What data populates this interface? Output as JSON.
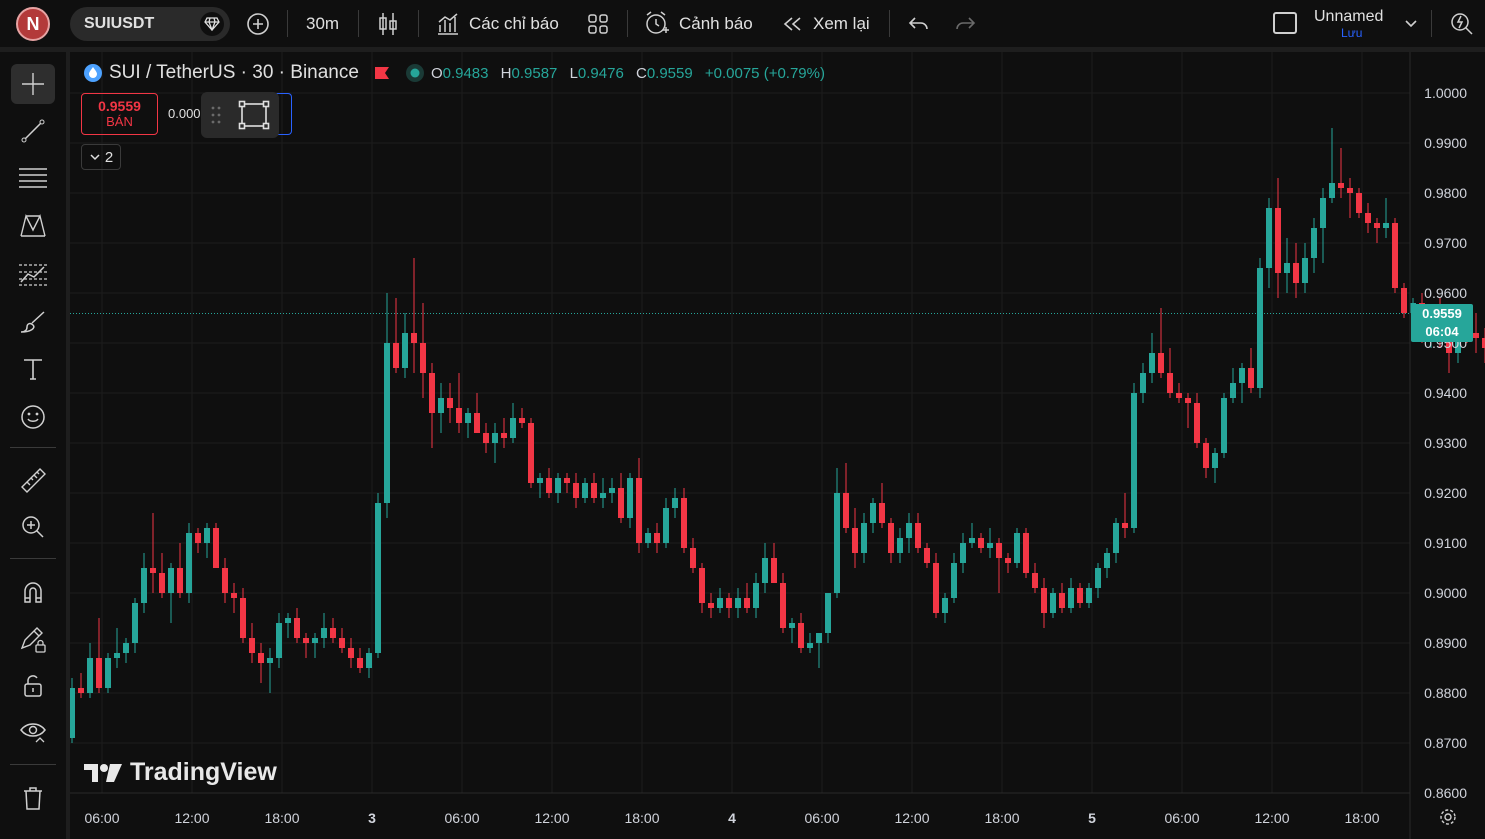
{
  "topbar": {
    "avatar_letter": "N",
    "symbol": "SUIUSDT",
    "interval": "30m",
    "indicators_label": "Các chỉ báo",
    "alerts_label": "Cảnh báo",
    "replay_label": "Xem lại",
    "layout_name": "Unnamed",
    "save_label": "Lưu"
  },
  "legend": {
    "title": "SUI / TetherUS · 30 · Binance",
    "o_key": "O",
    "o_val": "0.9483",
    "h_key": "H",
    "h_val": "0.9587",
    "l_key": "L",
    "l_val": "0.9476",
    "c_key": "C",
    "c_val": "0.9559",
    "change": "+0.0075 (+0.79%)"
  },
  "trade": {
    "sell_price": "0.9559",
    "sell_label": "BÁN",
    "spread": "0.000"
  },
  "collapse_count": "2",
  "watermark": "TradingView",
  "last_price": {
    "price": "0.9559",
    "countdown": "06:04"
  },
  "colors": {
    "up": "#26a69a",
    "down": "#f23645",
    "background": "#0f0f0f",
    "accent": "#2962ff"
  },
  "icons": {
    "crosshair": "crosshair-icon",
    "trendline": "trend-line-icon",
    "fib": "fib-retracement-icon",
    "pattern": "xabcd-pattern-icon",
    "forecast": "forecast-icon",
    "brush": "brush-icon",
    "text": "text-icon",
    "emoji": "emoji-icon",
    "ruler": "ruler-icon",
    "zoom": "zoom-in-icon",
    "magnet": "magnet-icon",
    "lock-draw": "lock-drawing-icon",
    "lock": "lock-icon",
    "eye": "eye-icon",
    "trash": "trash-icon"
  },
  "chart_data": {
    "type": "candlestick",
    "symbol": "SUI / TetherUS",
    "interval": "30",
    "exchange": "Binance",
    "y_ticks": [
      "1.0000",
      "0.9900",
      "0.9800",
      "0.9700",
      "0.9600",
      "0.9500",
      "0.9400",
      "0.9300",
      "0.9200",
      "0.9100",
      "0.9000",
      "0.8900",
      "0.8800",
      "0.8700",
      "0.8600"
    ],
    "x_ticks": [
      "06:00",
      "12:00",
      "18:00",
      "3",
      "06:00",
      "12:00",
      "18:00",
      "4",
      "06:00",
      "12:00",
      "18:00",
      "5",
      "06:00",
      "12:00",
      "18:00"
    ],
    "ylim": [
      0.86,
      1.0
    ],
    "last_close": 0.9559,
    "candles": [
      [
        0.871,
        0.883,
        0.87,
        0.881
      ],
      [
        0.881,
        0.884,
        0.879,
        0.88
      ],
      [
        0.88,
        0.89,
        0.879,
        0.887
      ],
      [
        0.887,
        0.895,
        0.88,
        0.881
      ],
      [
        0.881,
        0.888,
        0.88,
        0.887
      ],
      [
        0.887,
        0.893,
        0.885,
        0.888
      ],
      [
        0.888,
        0.891,
        0.886,
        0.89
      ],
      [
        0.89,
        0.899,
        0.888,
        0.898
      ],
      [
        0.898,
        0.908,
        0.896,
        0.905
      ],
      [
        0.905,
        0.916,
        0.9,
        0.904
      ],
      [
        0.904,
        0.908,
        0.899,
        0.9
      ],
      [
        0.9,
        0.906,
        0.894,
        0.905
      ],
      [
        0.905,
        0.91,
        0.899,
        0.9
      ],
      [
        0.9,
        0.914,
        0.898,
        0.912
      ],
      [
        0.912,
        0.913,
        0.908,
        0.91
      ],
      [
        0.91,
        0.914,
        0.907,
        0.913
      ],
      [
        0.913,
        0.914,
        0.905,
        0.905
      ],
      [
        0.905,
        0.907,
        0.898,
        0.9
      ],
      [
        0.9,
        0.902,
        0.896,
        0.899
      ],
      [
        0.899,
        0.901,
        0.89,
        0.891
      ],
      [
        0.891,
        0.894,
        0.886,
        0.888
      ],
      [
        0.888,
        0.89,
        0.882,
        0.886
      ],
      [
        0.886,
        0.889,
        0.88,
        0.887
      ],
      [
        0.887,
        0.896,
        0.885,
        0.894
      ],
      [
        0.894,
        0.896,
        0.891,
        0.895
      ],
      [
        0.895,
        0.897,
        0.89,
        0.891
      ],
      [
        0.891,
        0.892,
        0.887,
        0.89
      ],
      [
        0.89,
        0.892,
        0.887,
        0.891
      ],
      [
        0.891,
        0.896,
        0.889,
        0.893
      ],
      [
        0.893,
        0.895,
        0.89,
        0.891
      ],
      [
        0.891,
        0.893,
        0.888,
        0.889
      ],
      [
        0.889,
        0.891,
        0.885,
        0.887
      ],
      [
        0.887,
        0.889,
        0.884,
        0.885
      ],
      [
        0.885,
        0.889,
        0.883,
        0.888
      ],
      [
        0.888,
        0.92,
        0.887,
        0.918
      ],
      [
        0.918,
        0.96,
        0.915,
        0.95
      ],
      [
        0.95,
        0.959,
        0.944,
        0.945
      ],
      [
        0.945,
        0.956,
        0.943,
        0.952
      ],
      [
        0.952,
        0.967,
        0.944,
        0.95
      ],
      [
        0.95,
        0.958,
        0.939,
        0.944
      ],
      [
        0.944,
        0.946,
        0.929,
        0.936
      ],
      [
        0.936,
        0.942,
        0.932,
        0.939
      ],
      [
        0.939,
        0.942,
        0.934,
        0.937
      ],
      [
        0.937,
        0.944,
        0.932,
        0.934
      ],
      [
        0.934,
        0.937,
        0.931,
        0.936
      ],
      [
        0.936,
        0.94,
        0.933,
        0.932
      ],
      [
        0.932,
        0.934,
        0.928,
        0.93
      ],
      [
        0.93,
        0.934,
        0.926,
        0.932
      ],
      [
        0.932,
        0.935,
        0.929,
        0.931
      ],
      [
        0.931,
        0.938,
        0.93,
        0.935
      ],
      [
        0.935,
        0.937,
        0.933,
        0.934
      ],
      [
        0.934,
        0.935,
        0.921,
        0.922
      ],
      [
        0.922,
        0.924,
        0.919,
        0.923
      ],
      [
        0.923,
        0.925,
        0.919,
        0.92
      ],
      [
        0.92,
        0.924,
        0.918,
        0.923
      ],
      [
        0.923,
        0.924,
        0.92,
        0.922
      ],
      [
        0.922,
        0.924,
        0.917,
        0.919
      ],
      [
        0.919,
        0.923,
        0.918,
        0.922
      ],
      [
        0.922,
        0.924,
        0.918,
        0.919
      ],
      [
        0.919,
        0.923,
        0.917,
        0.92
      ],
      [
        0.92,
        0.923,
        0.918,
        0.921
      ],
      [
        0.921,
        0.924,
        0.914,
        0.915
      ],
      [
        0.915,
        0.924,
        0.913,
        0.923
      ],
      [
        0.923,
        0.927,
        0.908,
        0.91
      ],
      [
        0.91,
        0.913,
        0.909,
        0.912
      ],
      [
        0.912,
        0.914,
        0.908,
        0.91
      ],
      [
        0.91,
        0.919,
        0.909,
        0.917
      ],
      [
        0.917,
        0.921,
        0.915,
        0.919
      ],
      [
        0.919,
        0.921,
        0.908,
        0.909
      ],
      [
        0.909,
        0.911,
        0.904,
        0.905
      ],
      [
        0.905,
        0.906,
        0.896,
        0.898
      ],
      [
        0.898,
        0.9,
        0.895,
        0.897
      ],
      [
        0.897,
        0.901,
        0.896,
        0.899
      ],
      [
        0.899,
        0.9,
        0.895,
        0.897
      ],
      [
        0.897,
        0.901,
        0.895,
        0.899
      ],
      [
        0.899,
        0.902,
        0.896,
        0.897
      ],
      [
        0.897,
        0.904,
        0.895,
        0.902
      ],
      [
        0.902,
        0.91,
        0.9,
        0.907
      ],
      [
        0.907,
        0.91,
        0.902,
        0.902
      ],
      [
        0.902,
        0.904,
        0.892,
        0.893
      ],
      [
        0.893,
        0.895,
        0.89,
        0.894
      ],
      [
        0.894,
        0.896,
        0.888,
        0.889
      ],
      [
        0.889,
        0.892,
        0.888,
        0.89
      ],
      [
        0.89,
        0.892,
        0.885,
        0.892
      ],
      [
        0.892,
        0.899,
        0.89,
        0.9
      ],
      [
        0.9,
        0.925,
        0.899,
        0.92
      ],
      [
        0.92,
        0.926,
        0.912,
        0.913
      ],
      [
        0.913,
        0.917,
        0.905,
        0.908
      ],
      [
        0.908,
        0.916,
        0.906,
        0.914
      ],
      [
        0.914,
        0.919,
        0.912,
        0.918
      ],
      [
        0.918,
        0.922,
        0.913,
        0.914
      ],
      [
        0.914,
        0.915,
        0.906,
        0.908
      ],
      [
        0.908,
        0.913,
        0.906,
        0.911
      ],
      [
        0.911,
        0.916,
        0.908,
        0.914
      ],
      [
        0.914,
        0.916,
        0.908,
        0.909
      ],
      [
        0.909,
        0.91,
        0.905,
        0.906
      ],
      [
        0.906,
        0.908,
        0.895,
        0.896
      ],
      [
        0.896,
        0.9,
        0.894,
        0.899
      ],
      [
        0.899,
        0.908,
        0.898,
        0.906
      ],
      [
        0.906,
        0.912,
        0.904,
        0.91
      ],
      [
        0.91,
        0.914,
        0.909,
        0.911
      ],
      [
        0.911,
        0.912,
        0.908,
        0.909
      ],
      [
        0.909,
        0.913,
        0.907,
        0.91
      ],
      [
        0.91,
        0.911,
        0.9,
        0.907
      ],
      [
        0.907,
        0.908,
        0.904,
        0.906
      ],
      [
        0.906,
        0.913,
        0.905,
        0.912
      ],
      [
        0.912,
        0.913,
        0.903,
        0.904
      ],
      [
        0.904,
        0.906,
        0.9,
        0.901
      ],
      [
        0.901,
        0.903,
        0.893,
        0.896
      ],
      [
        0.896,
        0.901,
        0.895,
        0.9
      ],
      [
        0.9,
        0.902,
        0.896,
        0.897
      ],
      [
        0.897,
        0.903,
        0.896,
        0.901
      ],
      [
        0.901,
        0.902,
        0.897,
        0.898
      ],
      [
        0.898,
        0.902,
        0.897,
        0.901
      ],
      [
        0.901,
        0.906,
        0.899,
        0.905
      ],
      [
        0.905,
        0.909,
        0.903,
        0.908
      ],
      [
        0.908,
        0.915,
        0.906,
        0.914
      ],
      [
        0.914,
        0.92,
        0.911,
        0.913
      ],
      [
        0.913,
        0.942,
        0.912,
        0.94
      ],
      [
        0.94,
        0.946,
        0.938,
        0.944
      ],
      [
        0.944,
        0.952,
        0.942,
        0.948
      ],
      [
        0.948,
        0.957,
        0.943,
        0.944
      ],
      [
        0.944,
        0.949,
        0.939,
        0.94
      ],
      [
        0.94,
        0.942,
        0.938,
        0.939
      ],
      [
        0.939,
        0.94,
        0.933,
        0.938
      ],
      [
        0.938,
        0.94,
        0.929,
        0.93
      ],
      [
        0.93,
        0.931,
        0.923,
        0.925
      ],
      [
        0.925,
        0.929,
        0.922,
        0.928
      ],
      [
        0.928,
        0.94,
        0.927,
        0.939
      ],
      [
        0.939,
        0.945,
        0.938,
        0.942
      ],
      [
        0.942,
        0.946,
        0.938,
        0.945
      ],
      [
        0.945,
        0.949,
        0.94,
        0.941
      ],
      [
        0.941,
        0.967,
        0.939,
        0.965
      ],
      [
        0.965,
        0.979,
        0.961,
        0.977
      ],
      [
        0.977,
        0.983,
        0.959,
        0.964
      ],
      [
        0.964,
        0.971,
        0.96,
        0.966
      ],
      [
        0.966,
        0.97,
        0.959,
        0.962
      ],
      [
        0.962,
        0.97,
        0.96,
        0.967
      ],
      [
        0.967,
        0.975,
        0.964,
        0.973
      ],
      [
        0.973,
        0.981,
        0.966,
        0.979
      ],
      [
        0.979,
        0.993,
        0.978,
        0.982
      ],
      [
        0.982,
        0.989,
        0.979,
        0.981
      ],
      [
        0.981,
        0.983,
        0.975,
        0.98
      ],
      [
        0.98,
        0.981,
        0.975,
        0.976
      ],
      [
        0.976,
        0.978,
        0.972,
        0.974
      ],
      [
        0.974,
        0.975,
        0.97,
        0.973
      ],
      [
        0.973,
        0.979,
        0.971,
        0.974
      ],
      [
        0.974,
        0.975,
        0.96,
        0.961
      ],
      [
        0.961,
        0.962,
        0.955,
        0.956
      ],
      [
        0.956,
        0.959,
        0.953,
        0.958
      ],
      [
        0.958,
        0.96,
        0.95,
        0.951
      ],
      [
        0.951,
        0.956,
        0.949,
        0.953
      ],
      [
        0.953,
        0.959,
        0.949,
        0.952
      ],
      [
        0.952,
        0.956,
        0.944,
        0.948
      ],
      [
        0.948,
        0.956,
        0.946,
        0.953
      ],
      [
        0.953,
        0.955,
        0.95,
        0.952
      ],
      [
        0.952,
        0.956,
        0.948,
        0.951
      ],
      [
        0.951,
        0.953,
        0.946,
        0.949
      ],
      [
        0.949,
        0.955,
        0.948,
        0.954
      ],
      [
        0.954,
        0.958,
        0.952,
        0.953
      ],
      [
        0.953,
        0.959,
        0.951,
        0.955
      ],
      [
        0.955,
        0.956,
        0.947,
        0.949
      ],
      [
        0.949,
        0.953,
        0.947,
        0.95
      ],
      [
        0.95,
        0.952,
        0.946,
        0.951
      ],
      [
        0.951,
        0.959,
        0.95,
        0.957
      ],
      [
        0.957,
        0.959,
        0.952,
        0.956
      ],
      [
        0.956,
        0.957,
        0.943,
        0.947
      ],
      [
        0.947,
        0.948,
        0.943,
        0.945
      ],
      [
        0.945,
        0.95,
        0.943,
        0.949
      ],
      [
        0.9483,
        0.9587,
        0.9476,
        0.9559
      ]
    ]
  }
}
